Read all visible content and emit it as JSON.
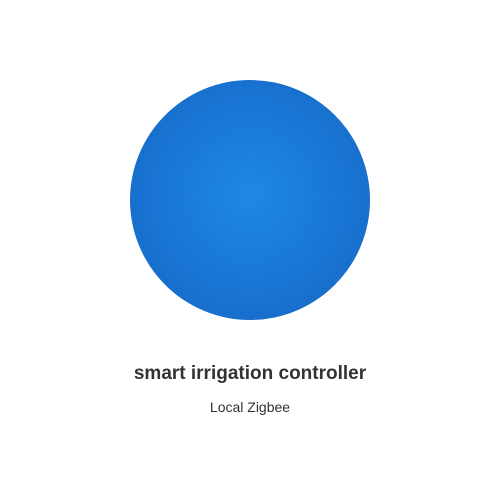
{
  "device": {
    "name": "smart irrigation controller",
    "protocol": "Local Zigbee",
    "image_color": "#1e88e5",
    "image_icon": "device-circle-icon"
  }
}
